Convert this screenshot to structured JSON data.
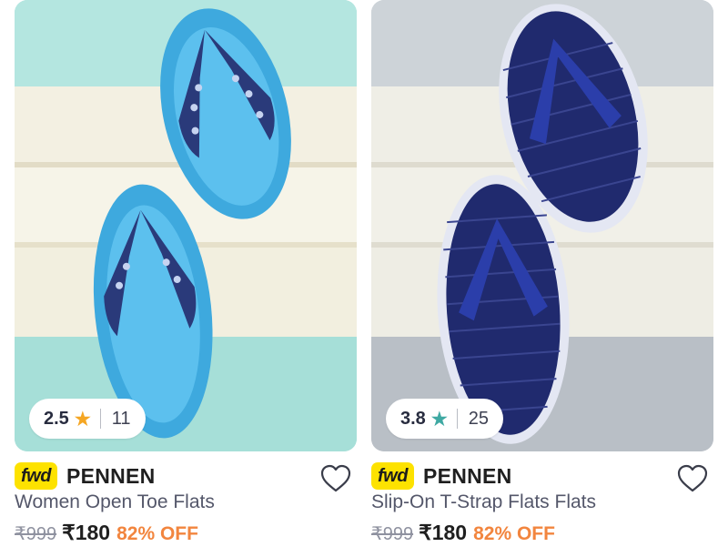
{
  "products": [
    {
      "rating": "2.5",
      "rating_count": "11",
      "star_color": "#f5a623",
      "tag": "fwd",
      "brand": "PENNEN",
      "name": "Women Open Toe Flats",
      "mrp": "₹999",
      "price": "₹180",
      "discount": "82% OFF",
      "image_icon": "blue-embellished-flip-flops"
    },
    {
      "rating": "3.8",
      "rating_count": "25",
      "star_color": "#3fa9a3",
      "tag": "fwd",
      "brand": "PENNEN",
      "name": "Slip-On T-Strap Flats Flats",
      "mrp": "₹999",
      "price": "₹180",
      "discount": "82% OFF",
      "image_icon": "navy-t-strap-flip-flops"
    }
  ],
  "colors": {
    "fwd_badge": "#fde200",
    "discount": "#f2853e"
  },
  "icons": {
    "wishlist": "heart-outline-icon",
    "star": "star-icon"
  }
}
